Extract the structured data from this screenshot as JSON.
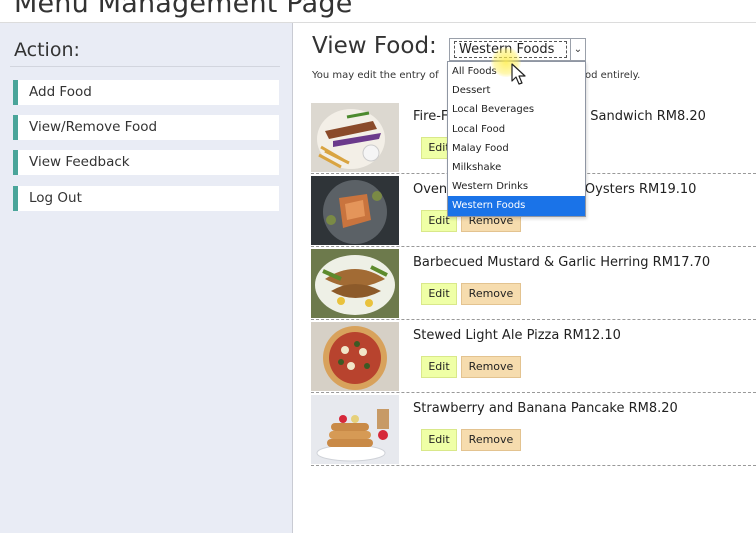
{
  "page": {
    "title": "Menu Management Page"
  },
  "sidebar": {
    "heading": "Action:",
    "items": [
      {
        "label": "Add Food"
      },
      {
        "label": "View/Remove Food"
      },
      {
        "label": "View Feedback"
      },
      {
        "label": "Log Out"
      }
    ]
  },
  "main": {
    "view_label": "View Food:",
    "filter": {
      "selected": "Western Foods",
      "options": [
        "All Foods",
        "Dessert",
        "Local Beverages",
        "Local Food",
        "Malay Food",
        "Milkshake",
        "Western Drinks",
        "Western Foods"
      ]
    },
    "hint_left": "You may edit the entry of",
    "hint_right": "od entirely.",
    "foods": [
      {
        "name_left": "Fire-F",
        "name_right": "Garlic Sandwich RM8.20",
        "edit": "Edit",
        "remove": "Remove"
      },
      {
        "name_left": "Oven",
        "name_right": "room Oysters RM19.10",
        "edit": "Edit",
        "remove": "Remove"
      },
      {
        "name": "Barbecued Mustard & Garlic Herring RM17.70",
        "edit": "Edit",
        "remove": "Remove"
      },
      {
        "name": "Stewed Light Ale Pizza RM12.10",
        "edit": "Edit",
        "remove": "Remove"
      },
      {
        "name": "Strawberry and Banana Pancake RM8.20",
        "edit": "Edit",
        "remove": "Remove"
      }
    ]
  }
}
